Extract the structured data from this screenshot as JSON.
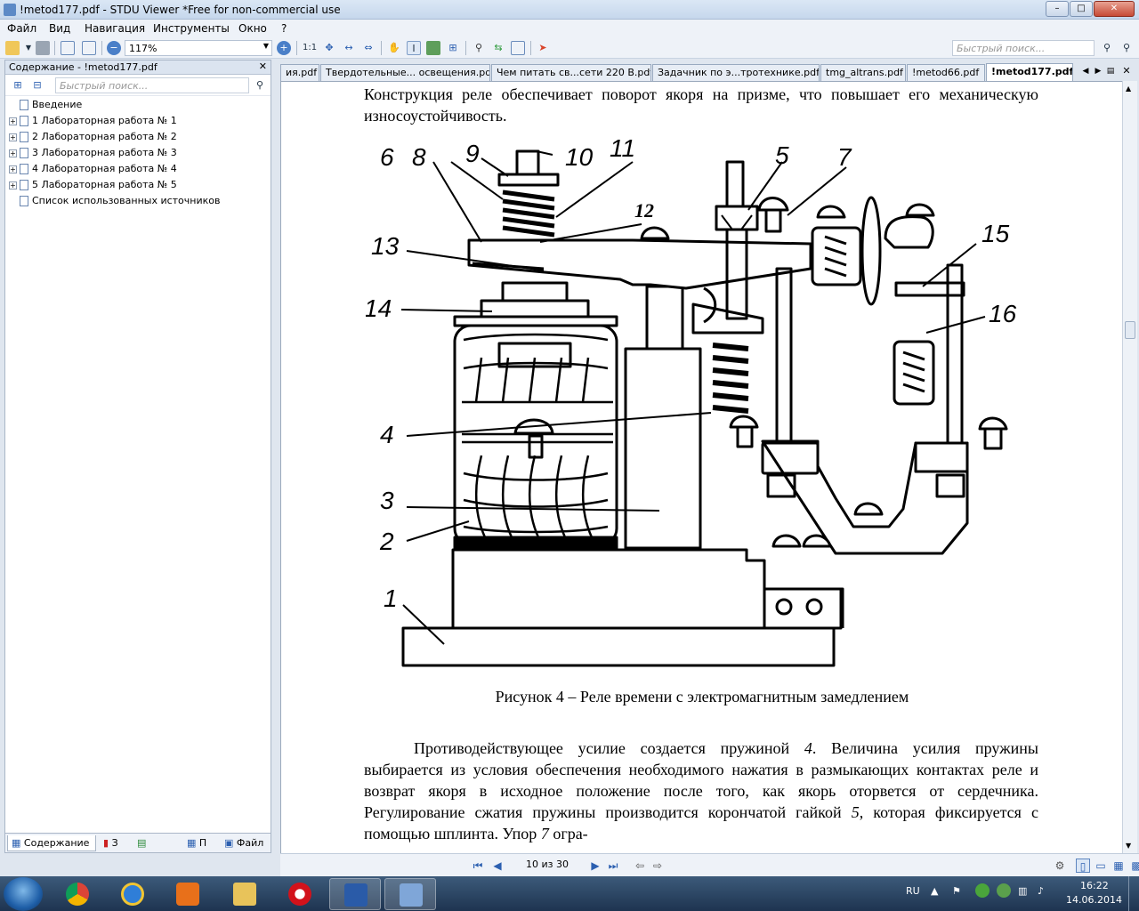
{
  "window": {
    "title": "!metod177.pdf - STDU Viewer *Free for non-commercial use",
    "controls": {
      "minimize": "–",
      "maximize": "□",
      "close": "✕"
    }
  },
  "menu": [
    "Файл",
    "Вид",
    "Навигация",
    "Инструменты",
    "Окно",
    "?"
  ],
  "toolbar": {
    "zoom": "117%",
    "actual_size": "1:1",
    "search_placeholder": "Быстрый поиск..."
  },
  "sidebar": {
    "title": "Содержание - !metod177.pdf",
    "close": "✕",
    "search_placeholder": "Быстрый поиск...",
    "items": [
      {
        "label": "Введение",
        "expandable": false
      },
      {
        "label": "1 Лабораторная работа № 1",
        "expandable": true
      },
      {
        "label": "2 Лабораторная работа № 2",
        "expandable": true
      },
      {
        "label": "3 Лабораторная работа № 3",
        "expandable": true
      },
      {
        "label": "4 Лабораторная работа № 4",
        "expandable": true
      },
      {
        "label": "5 Лабораторная работа № 5",
        "expandable": true
      },
      {
        "label": "Список использованных источников",
        "expandable": false
      }
    ],
    "bottom_tabs": [
      "Содержание",
      "З",
      "",
      "П",
      "Файл"
    ]
  },
  "tabs": [
    {
      "label": "ия.pdf",
      "active": false
    },
    {
      "label": "Твердотельные... освещения.pdf",
      "active": false
    },
    {
      "label": "Чем питать св...сети 220 В.pdf",
      "active": false
    },
    {
      "label": "Задачник по э...тротехнике.pdf",
      "active": false
    },
    {
      "label": "tmg_altrans.pdf",
      "active": false
    },
    {
      "label": "!metod66.pdf",
      "active": false
    },
    {
      "label": "!metod177.pdf",
      "active": true
    }
  ],
  "document": {
    "paragraph_top": "Конструкция реле обеспечивает поворот якоря на призме, что повышает его механическую износоустойчивость.",
    "figure_labels": [
      "6",
      "8",
      "9",
      "10",
      "11",
      "5",
      "7",
      "12",
      "13",
      "15",
      "14",
      "16",
      "4",
      "3",
      "2",
      "1"
    ],
    "caption": "Рисунок 4 – Реле времени с электромагнитным замедлением",
    "paragraph_bottom": {
      "t1": "Противодействующее усилие создается пружиной ",
      "i1": "4",
      "t2": ". Величина усилия пружины выбирается из условия обеспечения необходимого нажатия в размыкающих контактах реле и возврат якоря в исходное положение после того, как якорь оторвется от сердечника. Регулирование сжатия пружины производится корончатой гайкой ",
      "i2": "5",
      "t3": ", которая фиксируется с помощью шплинта. Упор ",
      "i3": "7",
      "t4": " огра-"
    }
  },
  "navigation": {
    "page_indicator": "10 из 30"
  },
  "taskbar": {
    "language": "RU",
    "time": "16:22",
    "date": "14.06.2014"
  }
}
